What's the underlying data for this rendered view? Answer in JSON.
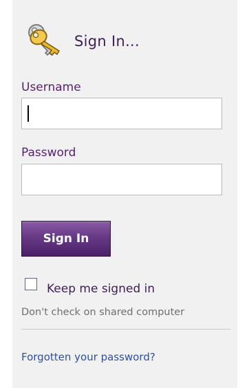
{
  "header": {
    "title": "Sign In...",
    "icon": "keys-icon"
  },
  "form": {
    "username_label": "Username",
    "username_value": "",
    "password_label": "Password",
    "password_value": "",
    "submit_label": "Sign In"
  },
  "remember": {
    "checked": false,
    "label": "Keep me signed in",
    "hint": "Don't check on shared computer"
  },
  "links": {
    "forgot_password": "Forgotten your password?"
  },
  "colors": {
    "panel_background": "#f1f1f1",
    "title_text": "#3f1d56",
    "label_text": "#5a1f70",
    "button_purple": "#4a1f68",
    "link_blue": "#2f4ea1"
  }
}
